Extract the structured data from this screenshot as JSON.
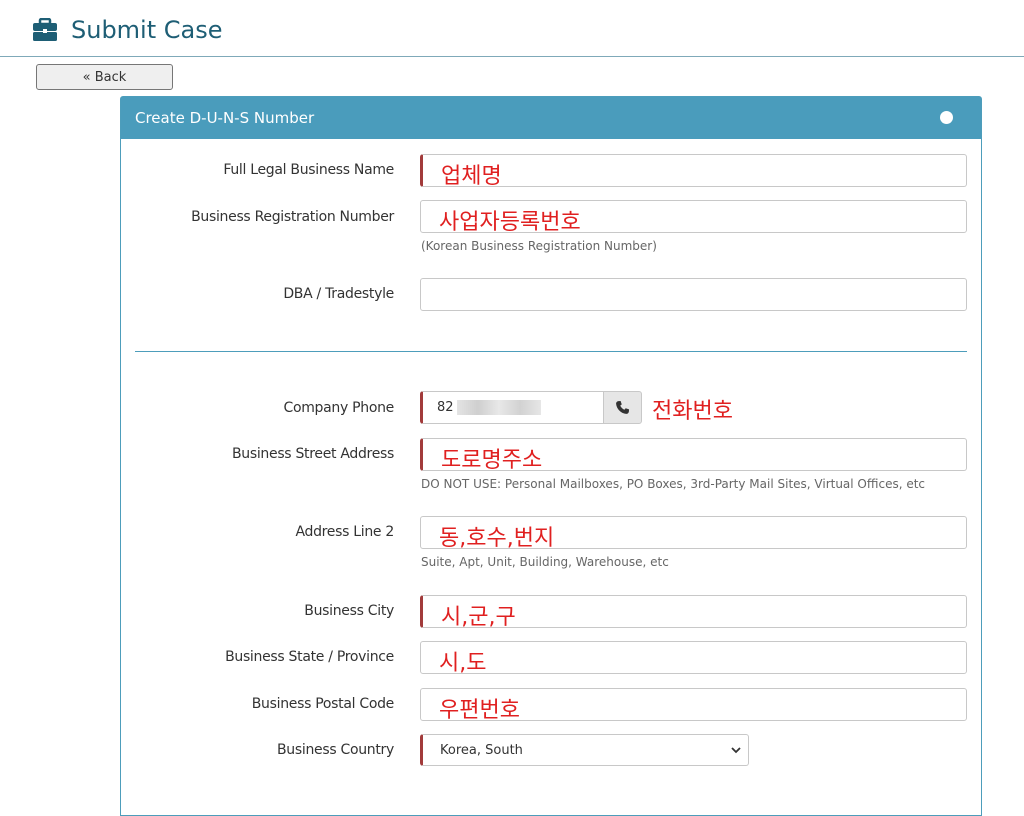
{
  "header": {
    "title": "Submit Case",
    "icon": "briefcase-icon",
    "color": "#1e5e75"
  },
  "back_button": {
    "label": "« Back"
  },
  "panel": {
    "title": "Create D-U-N-S Number",
    "accent": "#4a9cbc"
  },
  "fields": {
    "legal_name": {
      "label": "Full Legal Business Name",
      "value": "업체명"
    },
    "reg_number": {
      "label": "Business Registration Number",
      "value": "사업자등록번호",
      "help": "(Korean Business Registration Number)"
    },
    "dba": {
      "label": "DBA / Tradestyle",
      "value": ""
    },
    "phone": {
      "label": "Company Phone",
      "prefix": "82",
      "note": "전화번호",
      "icon": "phone-icon"
    },
    "street": {
      "label": "Business Street Address",
      "value": "도로명주소",
      "help": "DO NOT USE: Personal Mailboxes, PO Boxes, 3rd-Party Mail Sites, Virtual Offices, etc"
    },
    "address2": {
      "label": "Address Line 2",
      "value": "동,호수,번지",
      "help": "Suite, Apt, Unit, Building, Warehouse, etc"
    },
    "city": {
      "label": "Business City",
      "value": "시,군,구"
    },
    "state": {
      "label": "Business State / Province",
      "value": "시,도"
    },
    "postal": {
      "label": "Business Postal Code",
      "value": "우편번호"
    },
    "country": {
      "label": "Business Country",
      "value": "Korea, South"
    }
  }
}
